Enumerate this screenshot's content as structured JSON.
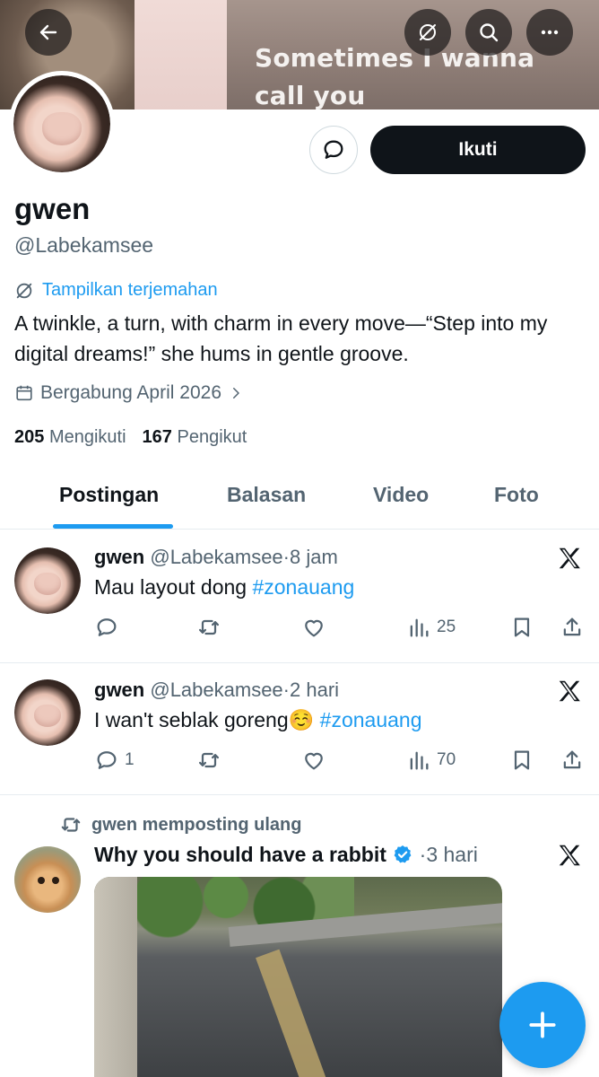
{
  "banner": {
    "caption": "Sometimes I wanna call you"
  },
  "header": {
    "back_icon": "arrow-left-icon",
    "translate_icon": "translate-icon",
    "search_icon": "search-icon",
    "more_icon": "more-horizontal-icon"
  },
  "profile": {
    "name": "gwen",
    "handle": "@Labekamsee",
    "follow_label": "Ikuti",
    "translate_label": "Tampilkan terjemahan",
    "bio": "A twinkle, a turn, with charm in every move—“Step into my digital dreams!” she hums in gentle groove.",
    "joined": "Bergabung April 2026",
    "following_count": "205",
    "following_label": "Mengikuti",
    "followers_count": "167",
    "followers_label": "Pengikut"
  },
  "tabs": [
    {
      "label": "Postingan",
      "active": true
    },
    {
      "label": "Balasan",
      "active": false
    },
    {
      "label": "Video",
      "active": false
    },
    {
      "label": "Foto",
      "active": false
    }
  ],
  "tweets": [
    {
      "name": "gwen",
      "handle": "@Labekamsee",
      "time": "·8 jam",
      "text": "Mau layout dong ",
      "hashtag": "#zonauang",
      "replies": "",
      "views": "25"
    },
    {
      "name": "gwen",
      "handle": "@Labekamsee",
      "time": "·2 hari",
      "text": "I wan't seblak goreng☺️ ",
      "hashtag": "#zonauang",
      "replies": "1",
      "views": "70"
    }
  ],
  "repost": {
    "label": "gwen memposting ulang",
    "name": "Why you should have a rabbit",
    "time": "·3 hari"
  },
  "colors": {
    "accent": "#1d9bf0",
    "text": "#0f1419",
    "muted": "#536471"
  }
}
